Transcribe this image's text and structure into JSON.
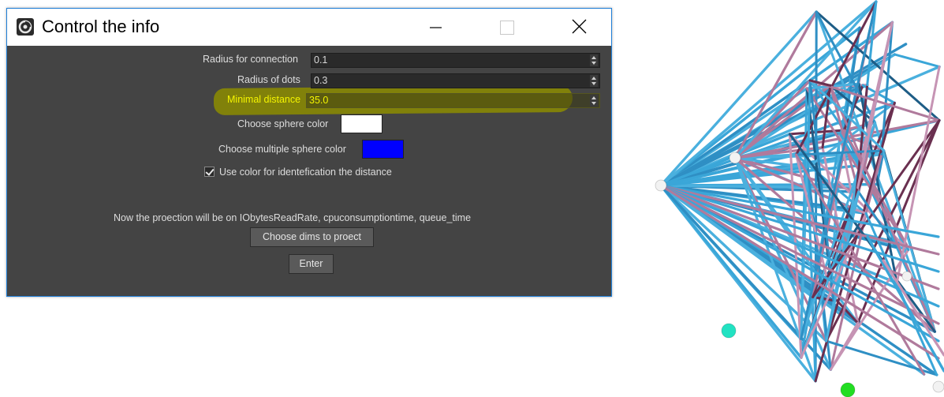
{
  "window": {
    "title": "Control the info",
    "icon": "app-logo-icon",
    "controls": [
      "minimize-icon",
      "maximize-icon",
      "close-icon"
    ]
  },
  "fields": {
    "radius_connection": {
      "label": "Radius for connection",
      "value": "0.1"
    },
    "radius_dots": {
      "label": "Radius of dots",
      "value": "0.3"
    },
    "minimal_distance": {
      "label": "Minimal distance",
      "value": "35.0"
    }
  },
  "colors": {
    "sphere_label": "Choose sphere color",
    "sphere_color": "#ffffff",
    "multiple_label": "Choose multiple sphere color",
    "multiple_color": "#0000ff",
    "highlight": "#8c8c00"
  },
  "checkbox": {
    "label": "Use color for identefication the distance",
    "checked": true
  },
  "projection_text": "Now the proection will be on IObytesReadRate, cpuconsumptiontime, queue_time",
  "buttons": {
    "choose_dims": "Choose dims to proect",
    "enter": "Enter"
  }
}
